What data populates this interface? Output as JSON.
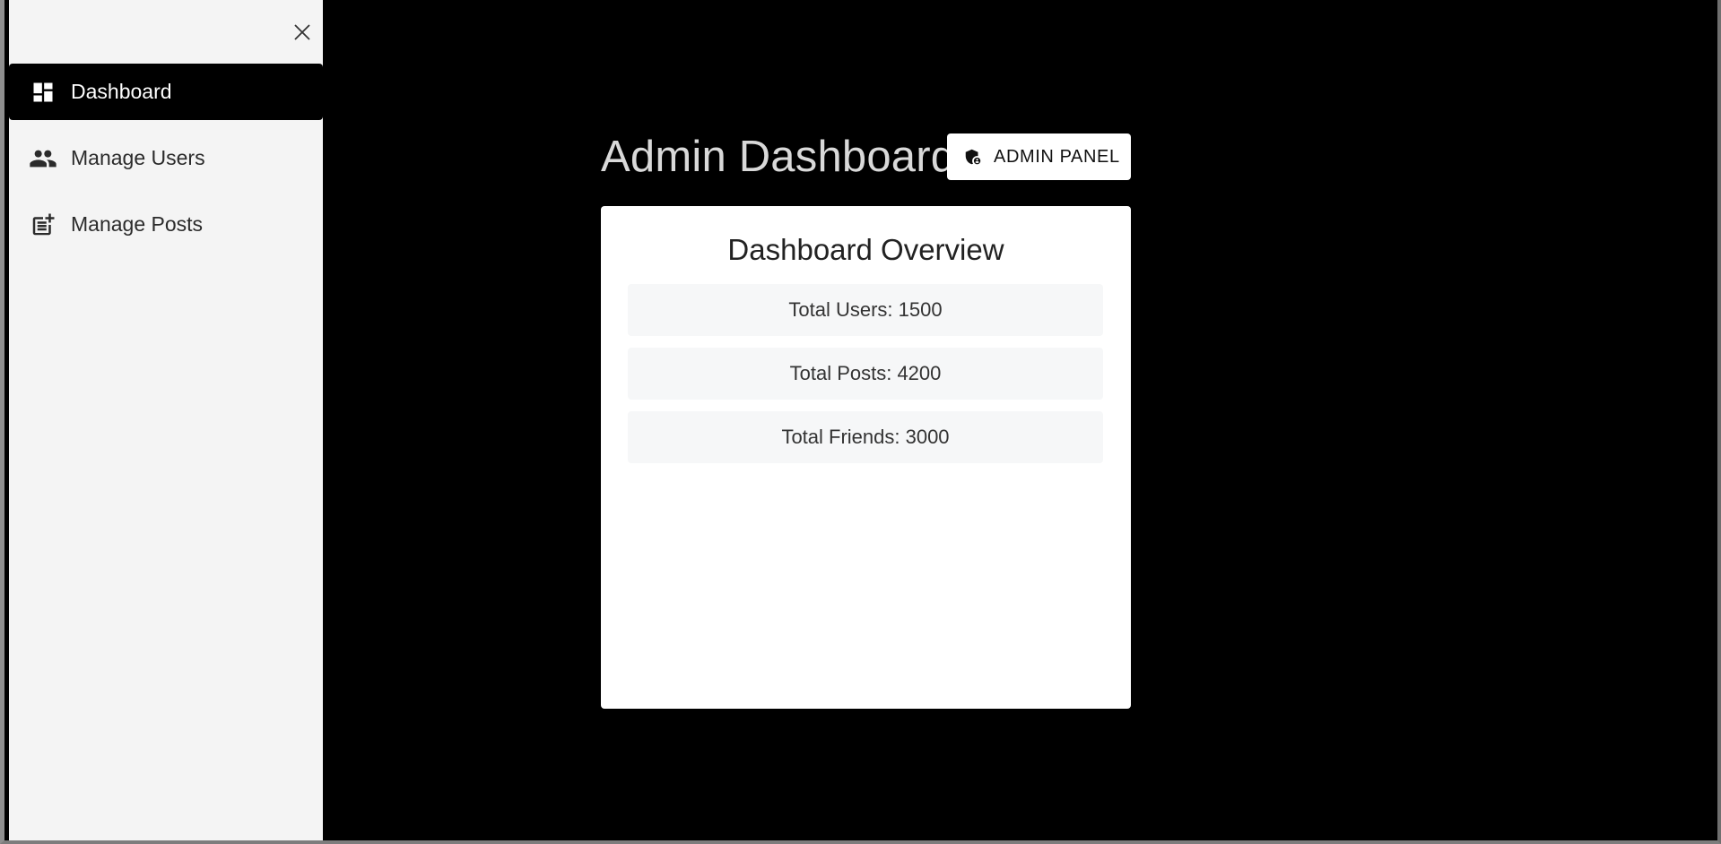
{
  "sidebar": {
    "close_icon": "close-icon",
    "items": [
      {
        "label": "Dashboard",
        "icon": "dashboard-icon",
        "active": true
      },
      {
        "label": "Manage Users",
        "icon": "people-icon",
        "active": false
      },
      {
        "label": "Manage Posts",
        "icon": "post-add-icon",
        "active": false
      }
    ]
  },
  "main": {
    "title": "Admin Dashboard",
    "admin_panel_button": {
      "label": "ADMIN PANEL",
      "icon": "admin-shield-icon"
    },
    "card": {
      "title": "Dashboard Overview",
      "stats": [
        "Total Users: 1500",
        "Total Posts: 4200",
        "Total Friends: 3000"
      ]
    }
  },
  "colors": {
    "page_background": "#000000",
    "sidebar_background": "#f4f4f4",
    "active_item_background": "#000000",
    "card_background": "#ffffff",
    "stat_background": "#f6f7f8",
    "title_text": "#d9d9d9"
  }
}
